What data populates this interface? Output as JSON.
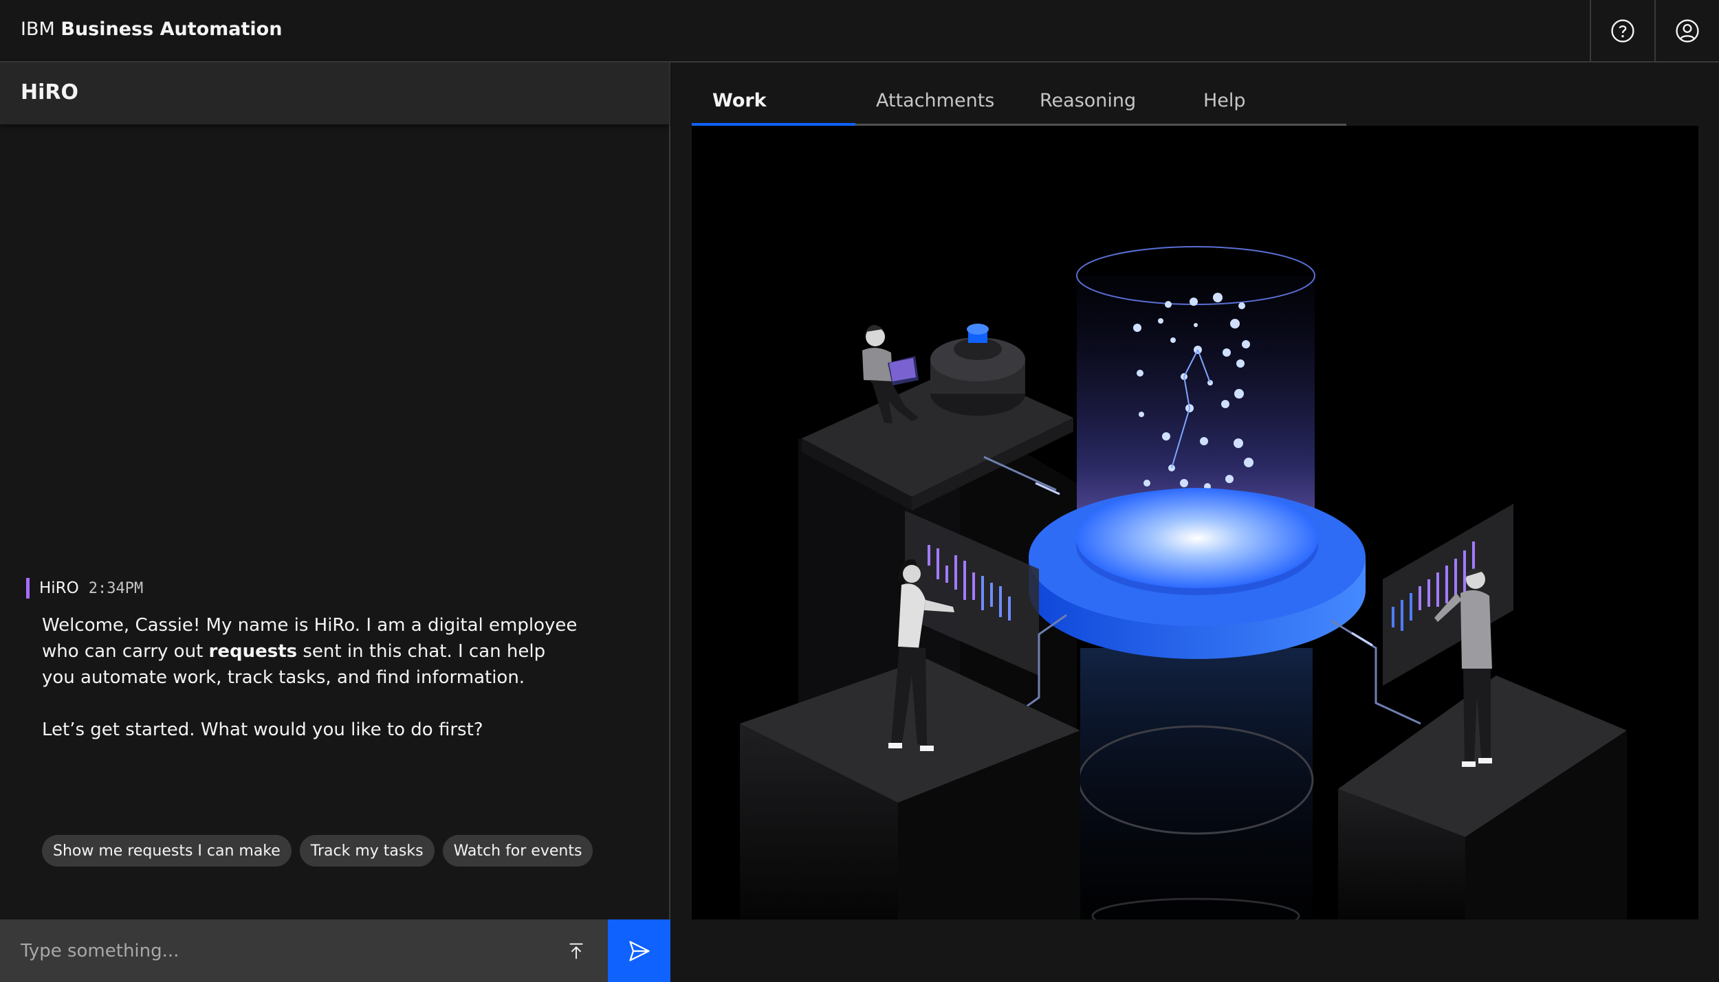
{
  "header": {
    "brand_prefix": "IBM",
    "brand_name": "Business Automation",
    "help_icon": "help-icon",
    "user_icon": "user-avatar-icon"
  },
  "chat": {
    "title": "HiRO",
    "message": {
      "sender": "HiRO",
      "time": "2:34PM",
      "line1_before": "Welcome, Cassie! My name is HiRo. I am a digital employee who can carry out ",
      "line1_bold": "requests",
      "line1_after": " sent in this chat. I can help you automate work, track tasks, and find information.",
      "line2": "Let’s get started. What would you like to do first?"
    },
    "suggestions": [
      "Show me requests I can make",
      "Track my tasks",
      "Watch for events"
    ],
    "composer": {
      "placeholder": "Type something...",
      "upload_icon": "upload-icon",
      "send_icon": "send-icon"
    }
  },
  "workspace": {
    "tabs": [
      "Work",
      "Attachments",
      "Reasoning",
      "Help"
    ],
    "active_tab": "Work"
  },
  "colors": {
    "accent": "#0f62fe",
    "sender_marker": "#a56eff",
    "background": "#161616",
    "panel_header": "#262626"
  }
}
